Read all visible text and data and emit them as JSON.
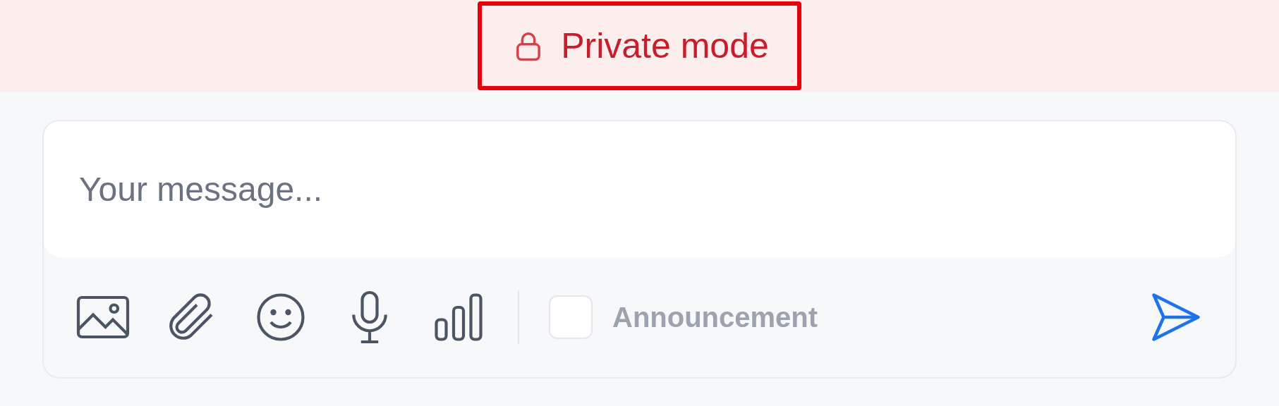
{
  "banner": {
    "label": "Private mode",
    "highlighted": true
  },
  "composer": {
    "placeholder": "Your message...",
    "announcement": {
      "label": "Announcement",
      "checked": false
    }
  }
}
